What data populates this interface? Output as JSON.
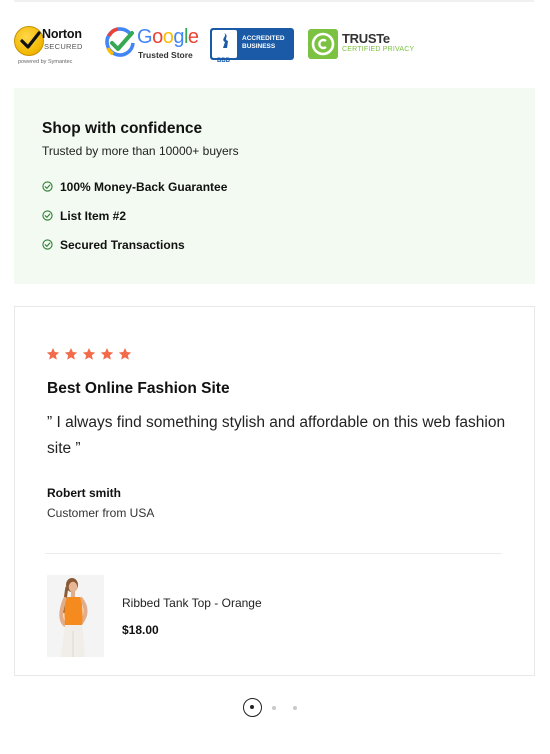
{
  "badges": {
    "norton": {
      "brand": "Norton",
      "sub": "SECURED",
      "powered": "powered by Symantec"
    },
    "google": {
      "wordmark": [
        "G",
        "o",
        "o",
        "g",
        "l",
        "e"
      ],
      "wordmark_colors": [
        "#4285f4",
        "#ea4335",
        "#fbbc05",
        "#4285f4",
        "#34a853",
        "#ea4335"
      ],
      "trusted": "Trusted Store"
    },
    "bbb": {
      "label": "BBB",
      "line1": "ACCREDITED",
      "line2": "BUSINESS",
      "color": "#1a5aa6"
    },
    "truste": {
      "name": "TRUSTe",
      "cert": "CERTIFIED PRIVACY",
      "color": "#7cc242"
    }
  },
  "confidence": {
    "title": "Shop with confidence",
    "subtitle": "Trusted by more than 10000+ buyers",
    "items": [
      "100% Money-Back Guarantee",
      "List Item #2",
      "Secured Transactions"
    ],
    "check_color": "#2e7d32",
    "background": "#f3faf2"
  },
  "review": {
    "rating": 5,
    "star_color": "#f26b4a",
    "title": "Best Online Fashion Site",
    "quote": "” I always find something stylish and affordable on this web fashion site ”",
    "author": "Robert smith",
    "location": "Customer from USA",
    "product": {
      "name": "Ribbed Tank Top - Orange",
      "price": "$18.00",
      "image_icon": "product-photo"
    }
  },
  "pagination": {
    "total": 3,
    "active": 1
  }
}
